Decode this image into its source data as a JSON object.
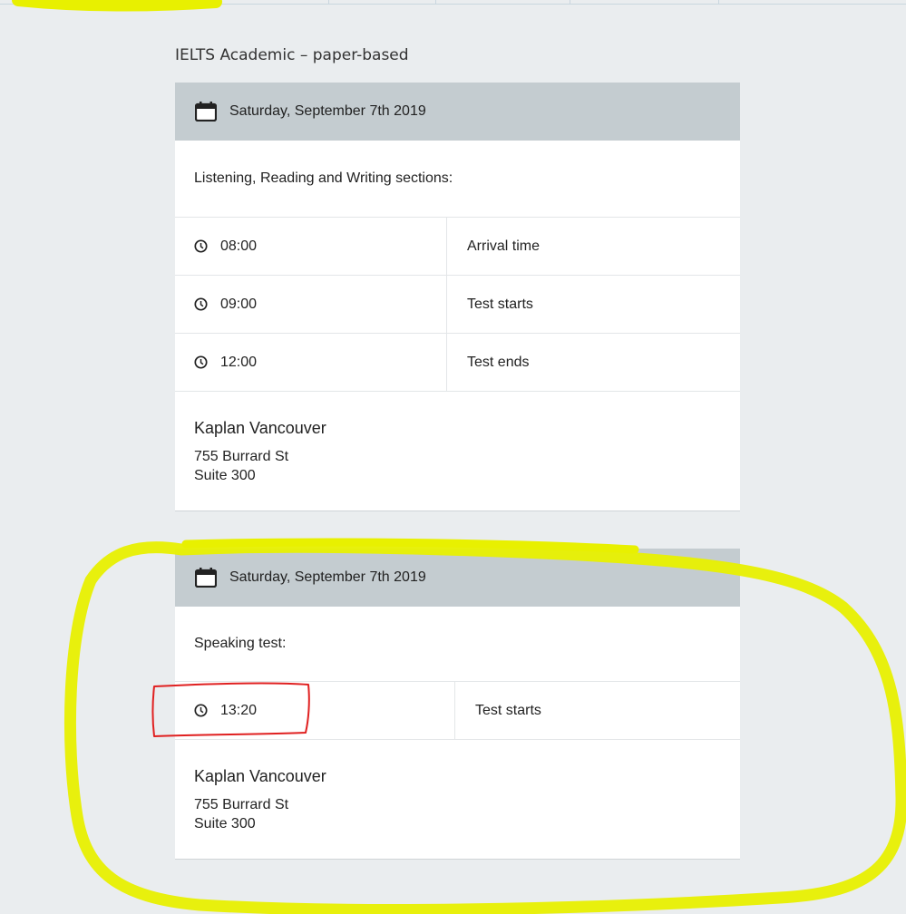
{
  "exam": {
    "title": "IELTS Academic – paper-based"
  },
  "cards": [
    {
      "date": "Saturday, September 7th 2019",
      "section": "Listening, Reading and Writing sections:",
      "rows": [
        {
          "time": "08:00",
          "label": "Arrival time"
        },
        {
          "time": "09:00",
          "label": "Test starts"
        },
        {
          "time": "12:00",
          "label": "Test ends"
        }
      ],
      "location": {
        "name": "Kaplan Vancouver",
        "address1": "755 Burrard St",
        "address2": "Suite 300"
      }
    },
    {
      "date": "Saturday, September 7th 2019",
      "section": "Speaking test:",
      "rows": [
        {
          "time": "13:20",
          "label": "Test starts"
        }
      ],
      "location": {
        "name": "Kaplan Vancouver",
        "address1": "755 Burrard St",
        "address2": "Suite 300"
      }
    }
  ],
  "annotations": {
    "highlight_color": "#e8f000",
    "box_color": "#e02020"
  }
}
